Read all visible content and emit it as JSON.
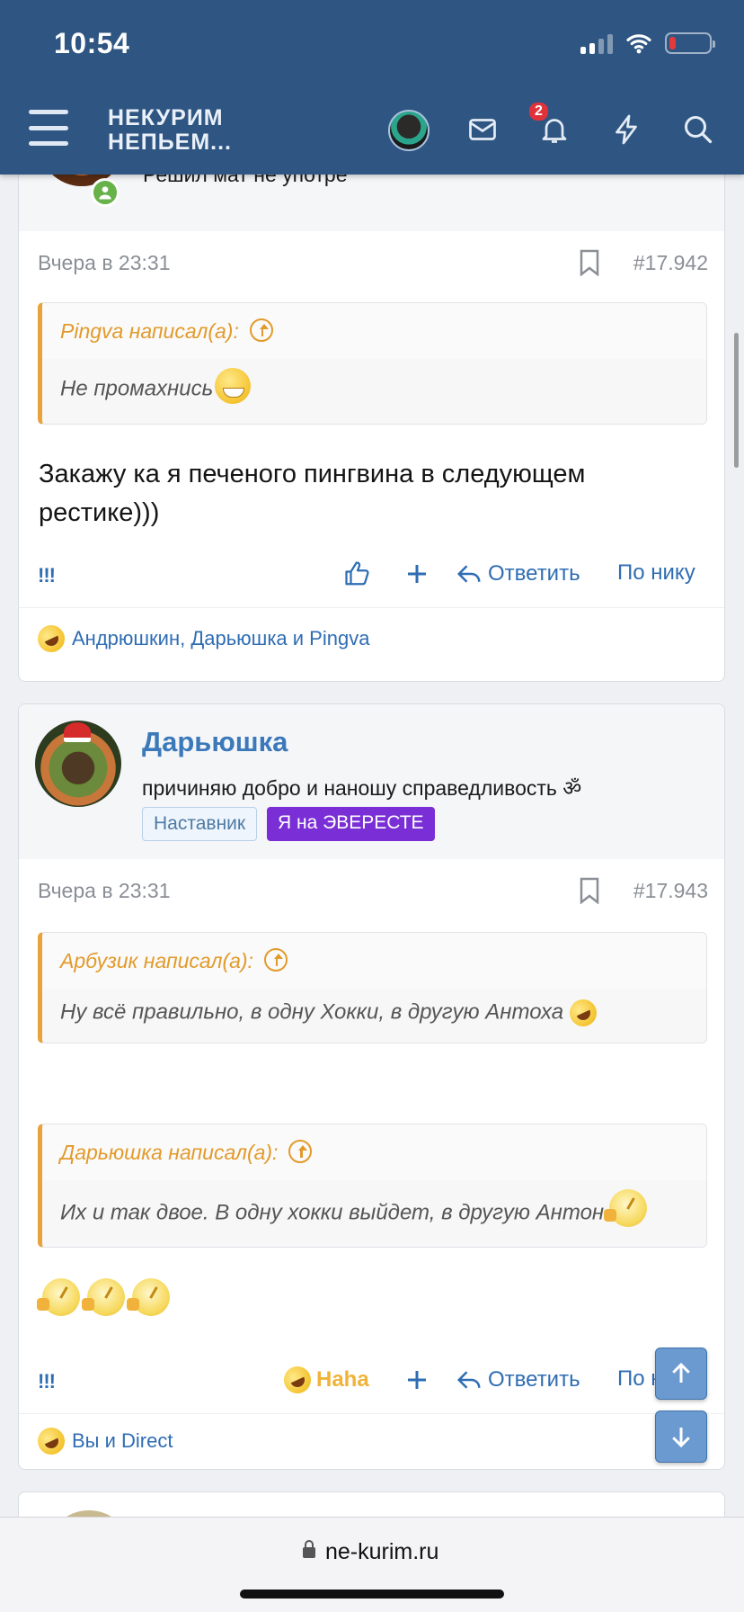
{
  "status": {
    "time": "10:54"
  },
  "header": {
    "logo_line1": "НЕКУРИМ",
    "logo_line2": "НЕПЬЕМ...",
    "notifications_count": "2"
  },
  "prev_post": {
    "author_title_fragment": "Решил мат не употре",
    "date": "Вчера в 23:31",
    "number": "#17.942",
    "quote": {
      "author_line": "Pingva написал(а):",
      "text": "Не промахнись"
    },
    "text_line1": "Закажу ка я печеного пингвина в следующем",
    "text_line2": "рестике)))",
    "actions": {
      "bang": "!!!",
      "reply": "Ответить",
      "by_nick": "По нику"
    },
    "reactions_text": "Андрюшкин, Дарьюшка и Pingva"
  },
  "post": {
    "author_name": "Дарьюшка",
    "author_title": "причиняю добро и наношу справедливость ॐ",
    "badges": [
      "Наставник",
      "Я на ЭВЕРЕСТЕ"
    ],
    "date": "Вчера в 23:31",
    "number": "#17.943",
    "quote1": {
      "author_line": "Арбузик написал(а):",
      "text": "Ну всё правильно, в одну Хокки, в другую Антоха"
    },
    "quote2": {
      "author_line": "Дарьюшка написал(а):",
      "text": "Их и так двое. В одну хокки выйдет, в другую Антон"
    },
    "actions": {
      "bang": "!!!",
      "reaction": "Haha",
      "reply": "Ответить",
      "by_nick": "По нику"
    },
    "reactions_text": "Вы и Direct"
  },
  "browser": {
    "url": "ne-kurim.ru"
  },
  "colors": {
    "header": "#2f5683",
    "link": "#2f6db3",
    "quote_accent": "#e8a33d",
    "badge_everest": "#7a2fd6"
  }
}
